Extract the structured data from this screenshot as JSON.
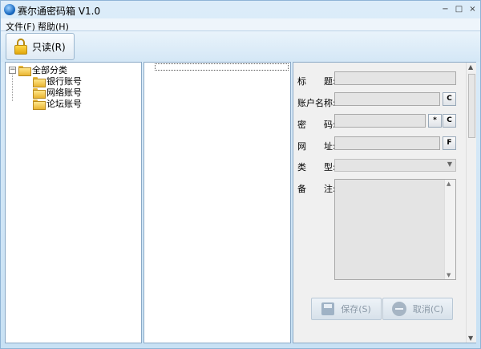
{
  "window": {
    "title": "赛尔通密码箱 V1.0",
    "minimize": "−",
    "maximize": "□",
    "close": "×"
  },
  "menu": {
    "file": "文件(F)",
    "help": "帮助(H)"
  },
  "toolbar": {
    "readonly_label": "只读(R)"
  },
  "tree": {
    "expander": "−",
    "root": "全部分类",
    "children": [
      "银行账号",
      "网络账号",
      "论坛账号"
    ]
  },
  "form": {
    "title_label": "标　　题:",
    "account_label": "账户名称:",
    "password_label": "密　　码:",
    "url_label": "网　　址:",
    "type_label": "类　　型:",
    "note_label": "备　　注:",
    "title_value": "",
    "account_value": "",
    "password_value": "",
    "url_value": "",
    "type_value": "",
    "note_value": "",
    "copy_btn": "C",
    "show_btn": "*",
    "open_btn": "F",
    "save_label": "保存(S)",
    "cancel_label": "取消(C)"
  }
}
